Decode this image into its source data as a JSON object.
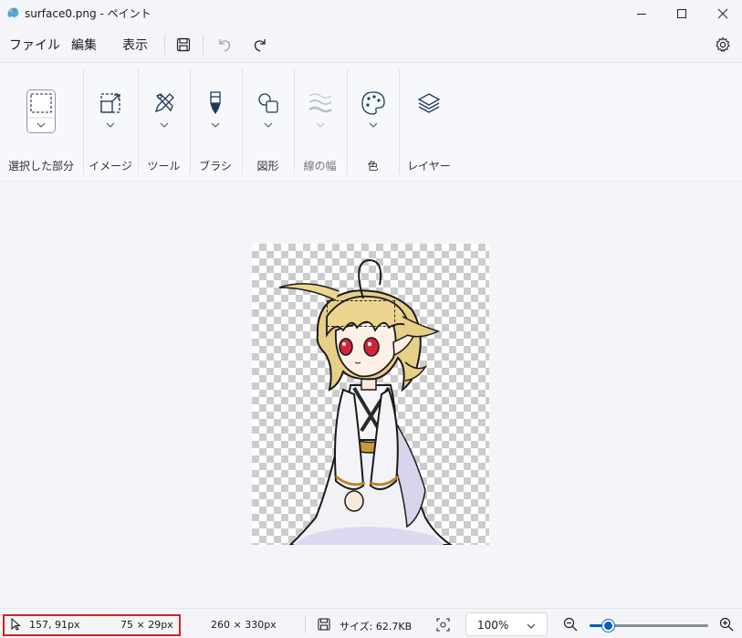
{
  "window": {
    "title": "surface0.png - ペイント",
    "icon": "paint-app-icon"
  },
  "menubar": {
    "file": "ファイル",
    "edit": "編集",
    "view": "表示"
  },
  "ribbon": {
    "selection": "選択した部分",
    "image": "イメージ",
    "tools": "ツール",
    "brush": "ブラシ",
    "shapes": "図形",
    "line_width": "線の幅",
    "color": "色",
    "layers": "レイヤー"
  },
  "status": {
    "cursor": "157, 91px",
    "selection_size": "75 × 29px",
    "image_size": "260 × 330px",
    "file_size": "サイズ: 62.7KB",
    "zoom": "100%",
    "zoom_fraction": 0.16
  },
  "colors": {
    "highlight": "#d62020",
    "accent": "#0a5fb4"
  }
}
